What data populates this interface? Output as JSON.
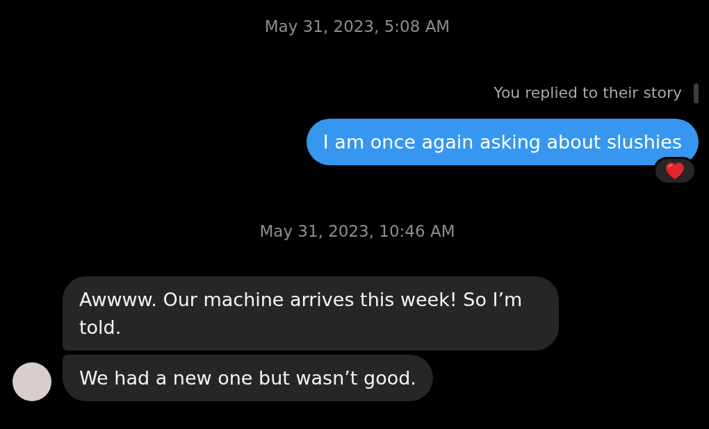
{
  "messages": [
    {
      "kind": "timestamp",
      "text": "May 31, 2023, 5:08 AM"
    },
    {
      "kind": "story_reply_note",
      "text": "You replied to their story"
    },
    {
      "kind": "sent",
      "text": "I am once again asking about slushies",
      "reacted": true
    },
    {
      "kind": "timestamp",
      "text": "May 31, 2023, 10:46 AM"
    },
    {
      "kind": "received",
      "text": "Awwww. Our machine arrives this week! So I’m told.",
      "avatar": false
    },
    {
      "kind": "received",
      "text": "We had a new one but wasn’t good.",
      "avatar": true
    }
  ]
}
